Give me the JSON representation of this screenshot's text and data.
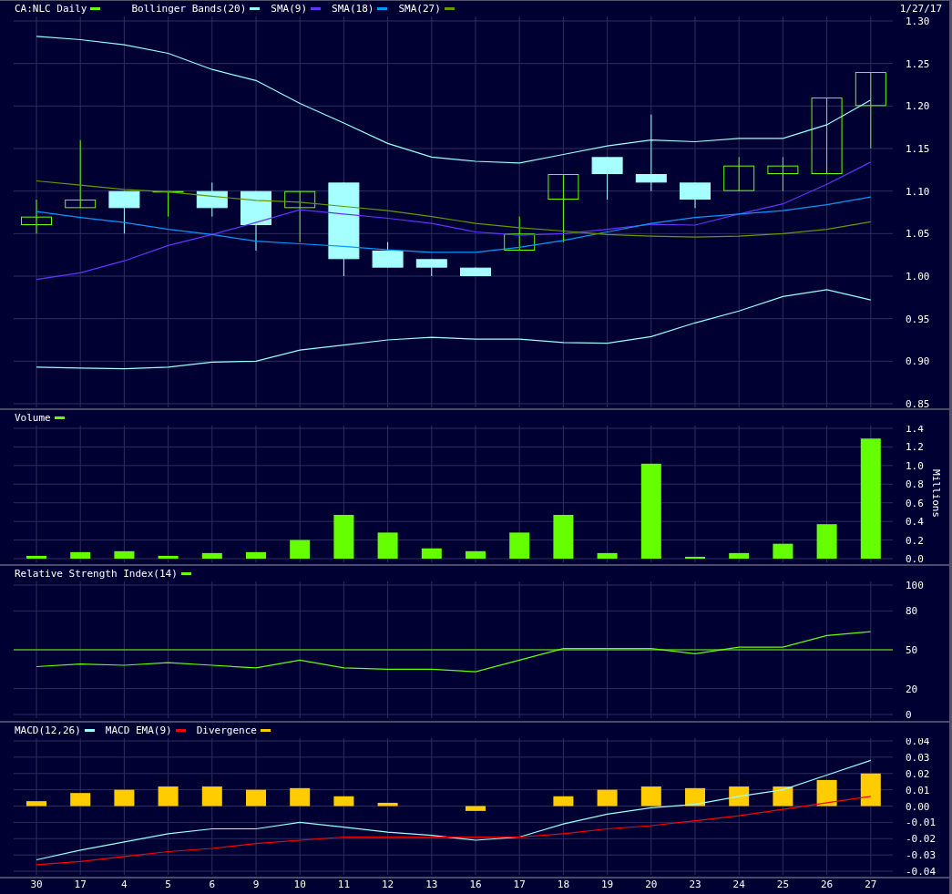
{
  "date": "1/27/17",
  "price": {
    "chart_data": {
      "type": "line",
      "grid": true,
      "ylim": [
        0.85,
        1.3
      ],
      "yticks": [
        {
          "value": 1.3,
          "label": "1.30"
        },
        {
          "value": 1.25,
          "label": "1.25"
        },
        {
          "value": 1.2,
          "label": "1.20"
        },
        {
          "value": 1.15,
          "label": "1.15"
        },
        {
          "value": 1.1,
          "label": "1.10"
        },
        {
          "value": 1.05,
          "label": "1.05"
        },
        {
          "value": 1.0,
          "label": "1.00"
        },
        {
          "value": 0.95,
          "label": "0.95"
        },
        {
          "value": 0.9,
          "label": "0.90"
        },
        {
          "value": 0.85,
          "label": "0.85"
        }
      ],
      "series": [
        {
          "name": "CA:NLC Daily",
          "type": "candlestick",
          "color": "#66ff00",
          "ohlc": [
            [
              1.06,
              1.09,
              1.05,
              1.07
            ],
            [
              1.08,
              1.16,
              1.08,
              1.09
            ],
            null,
            [
              1.1,
              1.1,
              1.07,
              1.1
            ],
            null,
            null,
            [
              1.08,
              1.1,
              1.04,
              1.1
            ],
            null,
            null,
            null,
            null,
            [
              1.03,
              1.07,
              1.03,
              1.05
            ],
            [
              1.09,
              1.12,
              1.04,
              1.12
            ],
            null,
            null,
            null,
            [
              1.1,
              1.14,
              1.1,
              1.13
            ],
            [
              1.12,
              1.14,
              1.1,
              1.13
            ],
            [
              1.12,
              1.21,
              1.12,
              1.21
            ],
            [
              1.2,
              1.24,
              1.15,
              1.24
            ]
          ]
        },
        {
          "type": "candlestick",
          "color": "#a6ffff",
          "ohlc": [
            null,
            null,
            [
              1.1,
              1.1,
              1.05,
              1.08
            ],
            null,
            [
              1.1,
              1.11,
              1.07,
              1.08
            ],
            [
              1.1,
              1.1,
              1.03,
              1.06
            ],
            null,
            [
              1.11,
              1.11,
              1.0,
              1.02
            ],
            [
              1.03,
              1.04,
              1.01,
              1.01
            ],
            [
              1.02,
              1.02,
              1.0,
              1.01
            ],
            [
              1.01,
              1.01,
              1.0,
              1.0
            ],
            null,
            null,
            [
              1.14,
              1.14,
              1.09,
              1.12
            ],
            [
              1.12,
              1.19,
              1.1,
              1.11
            ],
            [
              1.11,
              1.11,
              1.08,
              1.09
            ],
            null,
            null,
            null,
            null
          ]
        },
        {
          "name": "Bollinger Bands(20)",
          "color": "#99ffff",
          "values": [
            1.282,
            1.278,
            1.272,
            1.262,
            1.243,
            1.23,
            1.203,
            1.18,
            1.156,
            1.14,
            1.135,
            1.133,
            1.143,
            1.153,
            1.16,
            1.158,
            1.162,
            1.162,
            1.178,
            1.207
          ]
        },
        {
          "color": "#99ffff",
          "values": [
            0.893,
            0.892,
            0.891,
            0.893,
            0.899,
            0.9,
            0.913,
            0.919,
            0.925,
            0.928,
            0.926,
            0.926,
            0.922,
            0.921,
            0.929,
            0.945,
            0.959,
            0.976,
            0.984,
            0.972
          ]
        },
        {
          "name": "SMA(9)",
          "color": "#6633ff",
          "values": [
            0.996,
            1.004,
            1.018,
            1.036,
            1.049,
            1.063,
            1.078,
            1.073,
            1.068,
            1.062,
            1.052,
            1.048,
            1.05,
            1.055,
            1.061,
            1.06,
            1.073,
            1.085,
            1.108,
            1.134
          ]
        },
        {
          "name": "SMA(18)",
          "color": "#0099ff",
          "values": [
            1.076,
            1.069,
            1.063,
            1.055,
            1.049,
            1.041,
            1.038,
            1.035,
            1.031,
            1.028,
            1.028,
            1.034,
            1.042,
            1.052,
            1.062,
            1.069,
            1.073,
            1.077,
            1.084,
            1.093
          ]
        },
        {
          "name": "SMA(27)",
          "color": "#669900",
          "values": [
            1.112,
            1.107,
            1.102,
            1.099,
            1.094,
            1.089,
            1.087,
            1.082,
            1.077,
            1.07,
            1.062,
            1.057,
            1.053,
            1.049,
            1.047,
            1.046,
            1.047,
            1.05,
            1.055,
            1.064
          ]
        }
      ]
    }
  },
  "volume": {
    "chart_data": {
      "type": "bar",
      "grid": true,
      "ylabel": "Millions",
      "ylim": [
        0,
        1.4
      ],
      "yticks": [
        {
          "value": 1.4,
          "label": "1.4"
        },
        {
          "value": 1.2,
          "label": "1.2"
        },
        {
          "value": 1.0,
          "label": "1.0"
        },
        {
          "value": 0.8,
          "label": "0.8"
        },
        {
          "value": 0.6,
          "label": "0.6"
        },
        {
          "value": 0.4,
          "label": "0.4"
        },
        {
          "value": 0.2,
          "label": "0.2"
        },
        {
          "value": 0,
          "label": "0.0"
        }
      ],
      "series": [
        {
          "name": "Volume",
          "color": "#66ff00",
          "values": [
            0.03,
            0.07,
            0.08,
            0.03,
            0.06,
            0.07,
            0.2,
            0.47,
            0.28,
            0.11,
            0.08,
            0.28,
            0.47,
            0.06,
            1.02,
            0.02,
            0.06,
            0.16,
            0.37,
            1.29
          ]
        }
      ]
    }
  },
  "rsi": {
    "chart_data": {
      "type": "line",
      "grid": true,
      "ylim": [
        0,
        100
      ],
      "yticks": [
        100,
        80,
        50,
        20,
        0
      ],
      "ref_lines": [
        {
          "axis": "y",
          "value": 50,
          "color": "#66ff00"
        }
      ],
      "series": [
        {
          "name": "Relative Strength Index(14)",
          "color": "#66ff00",
          "values": [
            37,
            39,
            38,
            40,
            38,
            36,
            42,
            36,
            35,
            35,
            33,
            42,
            51,
            51,
            51,
            47,
            52,
            52,
            61,
            64
          ]
        }
      ]
    }
  },
  "macd": {
    "chart_data": {
      "type": "line",
      "grid": true,
      "ylim": [
        -0.04,
        0.04
      ],
      "categories": [
        "30",
        "17",
        "4",
        "5",
        "6",
        "9",
        "10",
        "11",
        "12",
        "13",
        "16",
        "17",
        "18",
        "19",
        "20",
        "23",
        "24",
        "25",
        "26",
        "27"
      ],
      "yticks": [
        {
          "value": 0.04,
          "label": "0.04"
        },
        {
          "value": 0.03,
          "label": "0.03"
        },
        {
          "value": 0.02,
          "label": "0.02"
        },
        {
          "value": 0.01,
          "label": "0.01"
        },
        {
          "value": 0,
          "label": "0.00"
        },
        {
          "value": -0.01,
          "label": "-0.01"
        },
        {
          "value": -0.02,
          "label": "-0.02"
        },
        {
          "value": -0.03,
          "label": "-0.03"
        },
        {
          "value": -0.04,
          "label": "-0.04"
        }
      ],
      "series": [
        {
          "name": "MACD(12,26)",
          "color": "#99ffff",
          "values": [
            -0.033,
            -0.027,
            -0.022,
            -0.017,
            -0.014,
            -0.014,
            -0.01,
            -0.013,
            -0.016,
            -0.018,
            -0.021,
            -0.019,
            -0.011,
            -0.005,
            -0.001,
            0.001,
            0.006,
            0.01,
            0.019,
            0.028
          ]
        },
        {
          "name": "MACD EMA(9)",
          "color": "#ff0000",
          "values": [
            -0.036,
            -0.034,
            -0.031,
            -0.028,
            -0.026,
            -0.023,
            -0.021,
            -0.019,
            -0.019,
            -0.019,
            -0.019,
            -0.019,
            -0.017,
            -0.014,
            -0.012,
            -0.009,
            -0.006,
            -0.002,
            0.002,
            0.006
          ]
        },
        {
          "name": "Divergence",
          "type": "bar",
          "color": "#ffcc00",
          "values": [
            0.003,
            0.008,
            0.01,
            0.012,
            0.012,
            0.01,
            0.011,
            0.006,
            0.002,
            null,
            -0.003,
            null,
            0.006,
            0.01,
            0.012,
            0.011,
            0.012,
            0.012,
            0.016,
            0.02
          ]
        }
      ]
    }
  }
}
